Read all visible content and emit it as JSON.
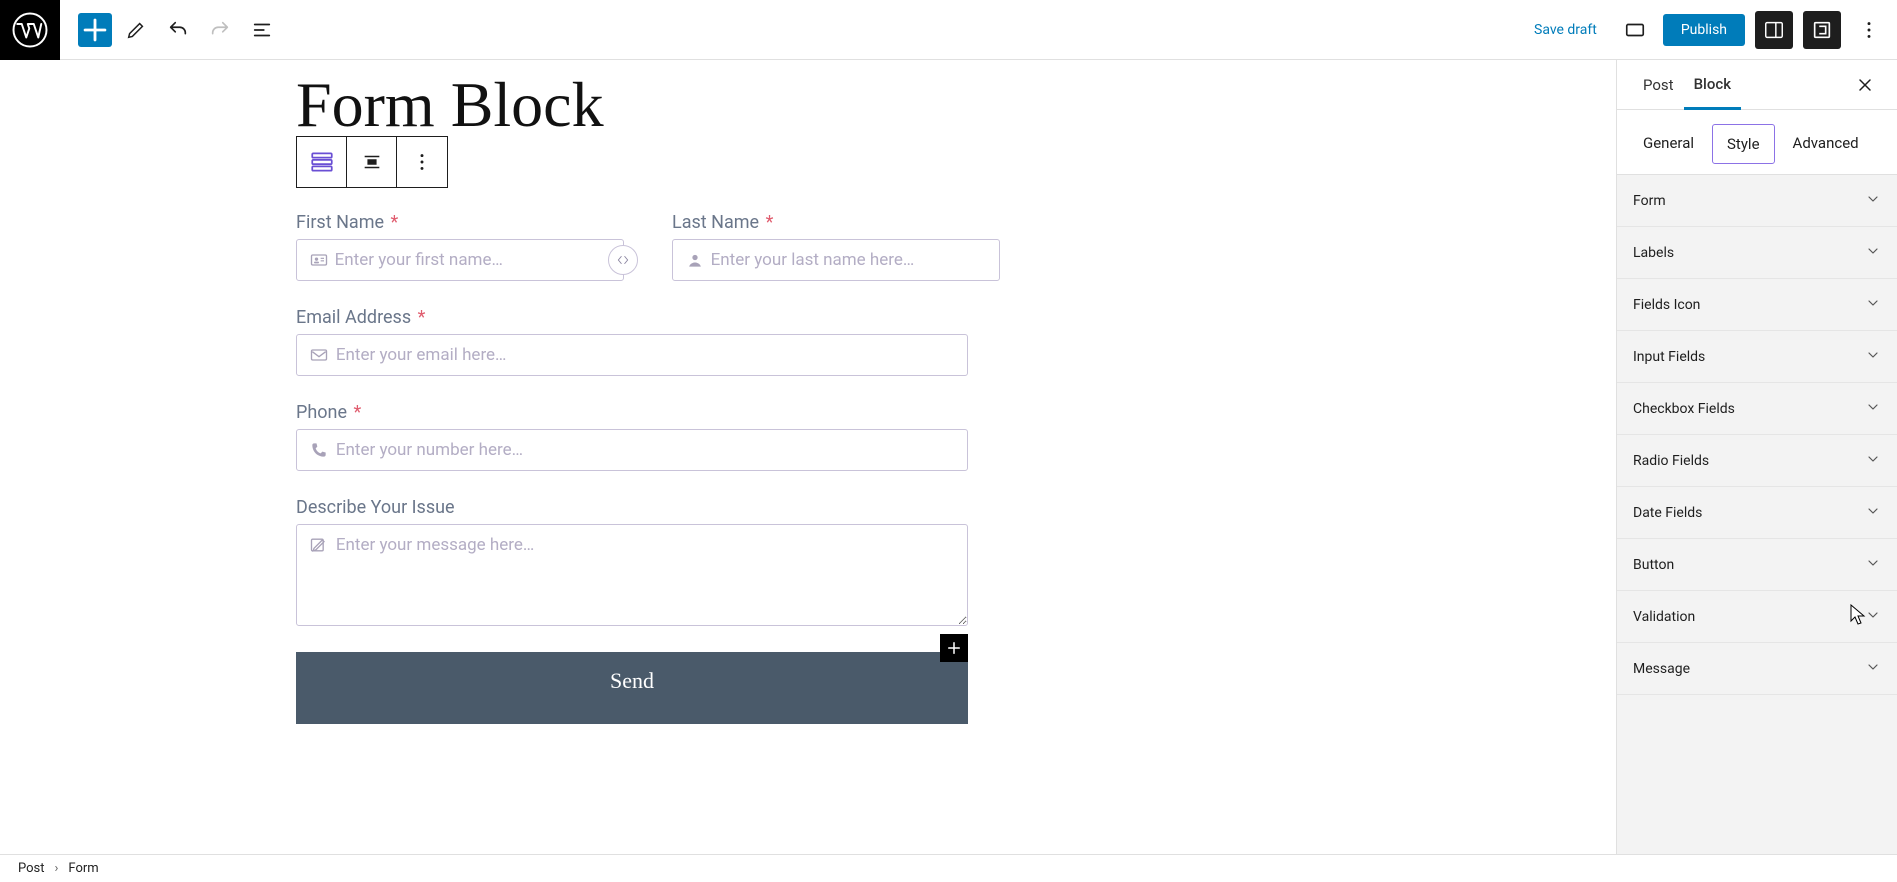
{
  "topbar": {
    "save_draft": "Save draft",
    "publish": "Publish"
  },
  "page": {
    "title": "Form Block"
  },
  "form": {
    "first_name_label": "First Name",
    "first_name_ph": "Enter your first name…",
    "last_name_label": "Last Name",
    "last_name_ph": "Enter your last name here…",
    "email_label": "Email Address",
    "email_ph": "Enter your email here…",
    "phone_label": "Phone",
    "phone_ph": "Enter your number here…",
    "message_label": "Describe Your Issue",
    "message_ph": "Enter your message here…",
    "submit_label": "Send",
    "required": "*"
  },
  "sidebar": {
    "tabs": {
      "post": "Post",
      "block": "Block"
    },
    "subtabs": {
      "general": "General",
      "style": "Style",
      "advanced": "Advanced"
    },
    "panels": [
      "Form",
      "Labels",
      "Fields Icon",
      "Input Fields",
      "Checkbox Fields",
      "Radio Fields",
      "Date Fields",
      "Button",
      "Validation",
      "Message"
    ]
  },
  "breadcrumb": {
    "a": "Post",
    "b": "Form"
  }
}
